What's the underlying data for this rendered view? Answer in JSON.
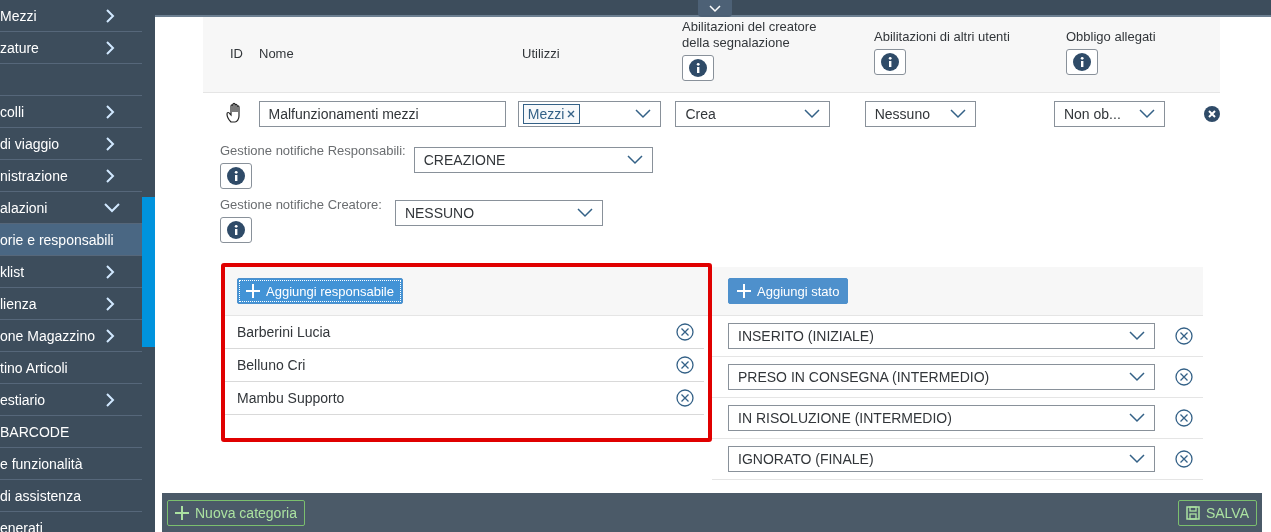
{
  "sidebar": {
    "items": [
      {
        "kind": "group",
        "label": "Mezzi",
        "expanded": false,
        "selected": false
      },
      {
        "kind": "group",
        "label": "zature",
        "expanded": false,
        "selected": false
      },
      {
        "kind": "spacer"
      },
      {
        "kind": "group",
        "label": "colli",
        "expanded": false,
        "selected": false
      },
      {
        "kind": "group",
        "label": "di viaggio",
        "expanded": false,
        "selected": false
      },
      {
        "kind": "group",
        "label": "nistrazione",
        "expanded": false,
        "selected": false
      },
      {
        "kind": "group",
        "label": "alazioni",
        "expanded": true,
        "selected": false
      },
      {
        "kind": "link",
        "label": "orie e responsabili",
        "selected": true
      },
      {
        "kind": "group",
        "label": "klist",
        "expanded": false,
        "selected": false
      },
      {
        "kind": "group",
        "label": "lienza",
        "expanded": false,
        "selected": false
      },
      {
        "kind": "group",
        "label": "one Magazzino",
        "expanded": false,
        "selected": false
      },
      {
        "kind": "link",
        "label": "tino Articoli",
        "selected": false
      },
      {
        "kind": "group",
        "label": "estiario",
        "expanded": false,
        "selected": false
      },
      {
        "kind": "link",
        "label": "BARCODE",
        "selected": false
      },
      {
        "kind": "link",
        "label": "e funzionalità",
        "selected": false
      },
      {
        "kind": "link",
        "label": "di assistenza",
        "selected": false
      },
      {
        "kind": "link",
        "label": "enerati",
        "selected": false
      }
    ]
  },
  "table": {
    "columns": [
      {
        "label": "ID"
      },
      {
        "label": "Nome"
      },
      {
        "label": "Utilizzi"
      },
      {
        "label": "Abilitazioni del creatore della segnalazione",
        "info": true
      },
      {
        "label": "Abilitazioni di altri utenti",
        "info": true
      },
      {
        "label": "Obbligo allegati",
        "info": true
      }
    ],
    "row": {
      "nome": "Malfunzionamenti mezzi",
      "utilizzi": [
        "Mezzi"
      ],
      "creatore": "Crea",
      "altri": "Nessuno",
      "allegati": "Non ob..."
    }
  },
  "notifications": [
    {
      "label": "Gestione notifiche Responsabili:",
      "value": "CREAZIONE"
    },
    {
      "label": "Gestione notifiche Creatore:",
      "value": "NESSUNO"
    }
  ],
  "responsabili": {
    "highlighted": true,
    "button": "Aggiungi responsabile",
    "items": [
      "Barberini Lucia",
      "Belluno Cri",
      "Mambu Supporto"
    ]
  },
  "stati": {
    "button": "Aggiungi stato",
    "items": [
      "INSERITO (INIZIALE)",
      "PRESO IN CONSEGNA (INTERMEDIO)",
      "IN RISOLUZIONE (INTERMEDIO)",
      "IGNORATO (FINALE)"
    ]
  },
  "footer": {
    "new_button": "Nuova categoria",
    "save_button": "SALVA"
  }
}
